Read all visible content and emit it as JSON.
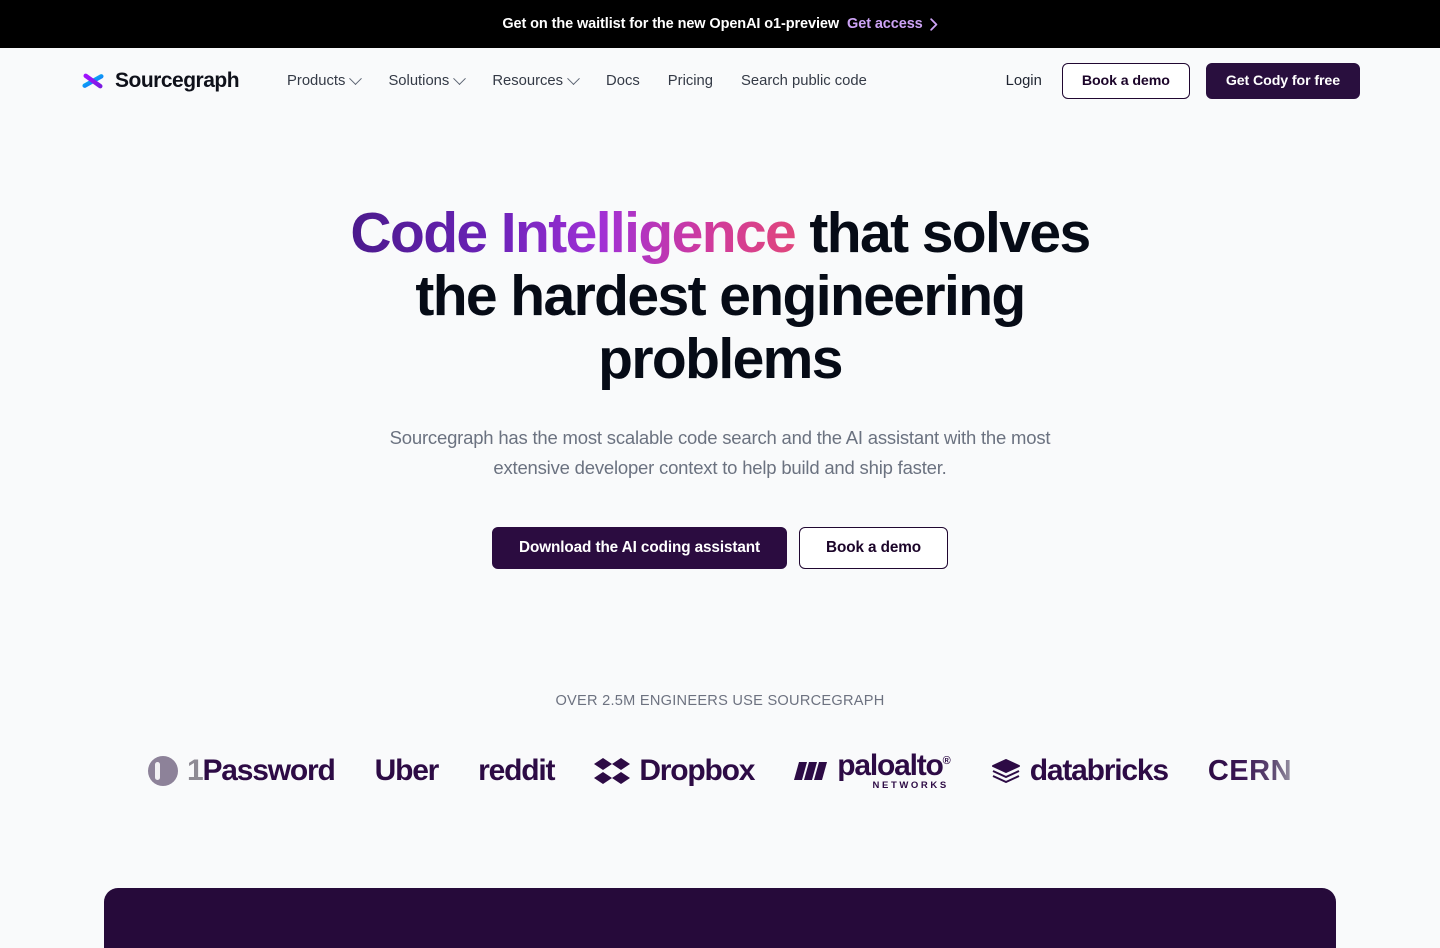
{
  "banner": {
    "text": "Get on the waitlist for the new OpenAI o1-preview",
    "link_label": "Get access",
    "chevron_icon": "chevron-right-icon",
    "background": "#000000",
    "link_color": "#cda3f5"
  },
  "header": {
    "brand": {
      "name": "Sourcegraph",
      "logo_icon": "sourcegraph-asterisk-logo"
    },
    "nav": [
      {
        "label": "Products",
        "has_dropdown": true
      },
      {
        "label": "Solutions",
        "has_dropdown": true
      },
      {
        "label": "Resources",
        "has_dropdown": true
      },
      {
        "label": "Docs",
        "has_dropdown": false
      },
      {
        "label": "Pricing",
        "has_dropdown": false
      },
      {
        "label": "Search public code",
        "has_dropdown": false
      }
    ],
    "login_label": "Login",
    "book_demo_label": "Book a demo",
    "get_cody_label": "Get Cody for free",
    "cta_color": "#290f3e"
  },
  "hero": {
    "title_gradient": "Code Intelligence",
    "title_rest": " that solves the hardest engineering problems",
    "subtitle": "Sourcegraph has the most scalable code search and the AI assistant with the most extensive developer context to help build and ship faster.",
    "primary_cta": "Download the AI coding assistant",
    "secondary_cta": "Book a demo",
    "gradient_start": "#4b1a8c",
    "gradient_end": "#e0467c"
  },
  "social_proof": {
    "label": "OVER 2.5M ENGINEERS USE SOURCEGRAPH",
    "logos": [
      {
        "name": "1Password",
        "prefix": "1",
        "word": "Password",
        "icon": "onepassword-circle-icon"
      },
      {
        "name": "Uber",
        "word": "Uber",
        "icon": null
      },
      {
        "name": "reddit",
        "word": "reddit",
        "icon": null
      },
      {
        "name": "Dropbox",
        "word": "Dropbox",
        "icon": "dropbox-diamond-icon"
      },
      {
        "name": "paloalto",
        "word": "paloalto",
        "sub": "NETWORKS",
        "icon": "paloalto-bars-icon"
      },
      {
        "name": "databricks",
        "word": "databricks",
        "icon": "databricks-layers-icon"
      },
      {
        "name": "CERN",
        "word": "CERN",
        "icon": null
      }
    ],
    "logo_color": "#2d0b45"
  },
  "page": {
    "background": "#f9fafb",
    "bottom_panel_color": "#260a3a"
  }
}
